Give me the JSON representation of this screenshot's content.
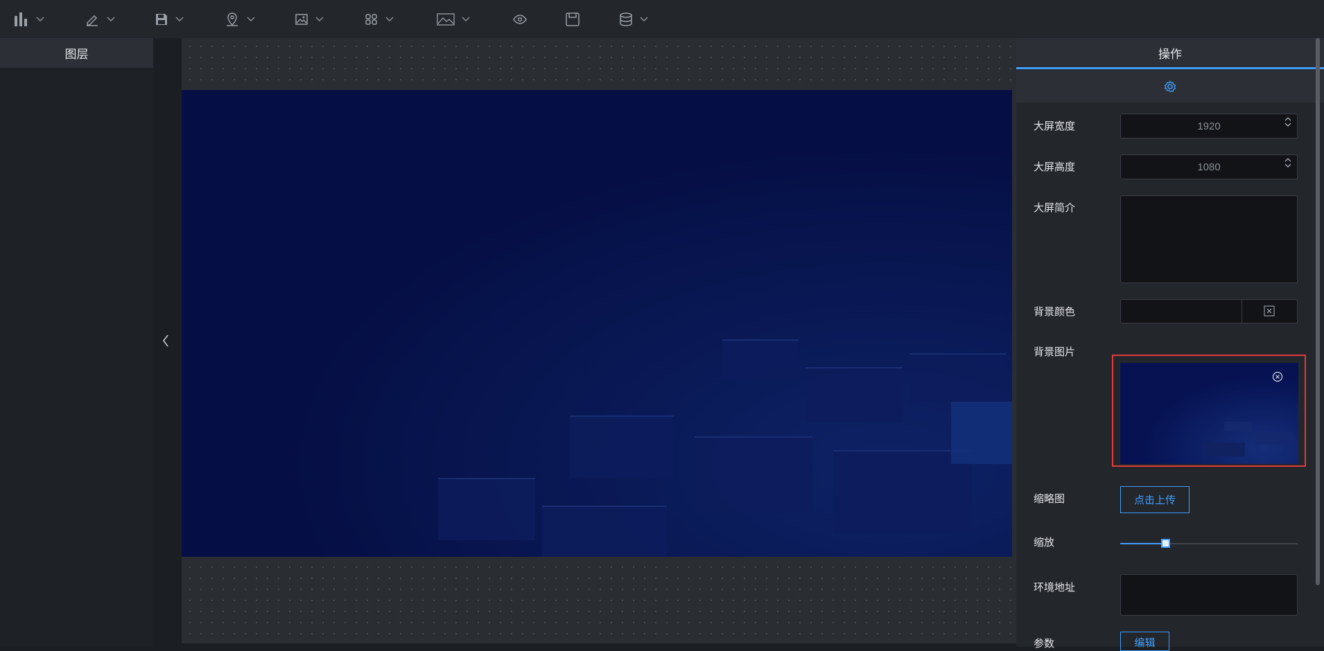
{
  "toolbar": {
    "items": [
      {
        "icon": "bar-chart-icon",
        "has_dropdown": true
      },
      {
        "icon": "pen-icon",
        "has_dropdown": true
      },
      {
        "icon": "save-icon",
        "has_dropdown": true
      },
      {
        "icon": "location-pin-icon",
        "has_dropdown": true
      },
      {
        "icon": "image-icon",
        "has_dropdown": true
      },
      {
        "icon": "grid-icon",
        "has_dropdown": true
      },
      {
        "icon": "picture-icon",
        "has_dropdown": true
      },
      {
        "icon": "eye-icon",
        "has_dropdown": false
      },
      {
        "icon": "floppy-icon",
        "has_dropdown": false
      },
      {
        "icon": "database-icon",
        "has_dropdown": true
      }
    ]
  },
  "left_panel": {
    "title": "图层"
  },
  "right_panel": {
    "tab": "操作",
    "fields": {
      "width_label": "大屏宽度",
      "width_value": "1920",
      "height_label": "大屏高度",
      "height_value": "1080",
      "intro_label": "大屏简介",
      "intro_value": "",
      "bgcolor_label": "背景颜色",
      "bgimage_label": "背景图片",
      "thumbnail_label": "缩略图",
      "upload_button": "点击上传",
      "zoom_label": "缩放",
      "zoom_value": 0.25,
      "env_label": "环境地址",
      "env_value": "",
      "params_label": "参数",
      "params_button": "编辑"
    }
  },
  "colors": {
    "accent": "#409eff",
    "highlight": "#e33b3b",
    "screen_bg": "#050f45"
  }
}
